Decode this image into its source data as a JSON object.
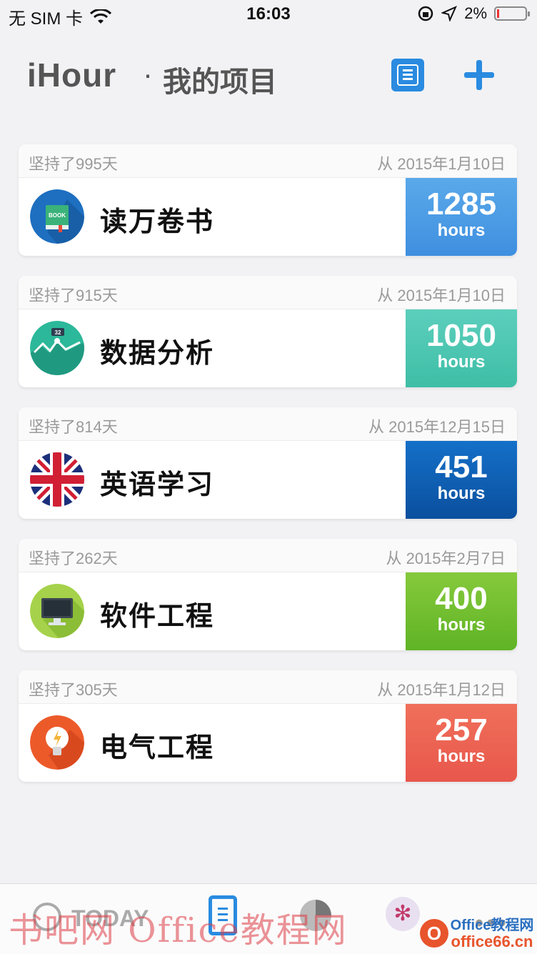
{
  "status_bar": {
    "carrier": "无 SIM 卡",
    "time": "16:03",
    "battery": "2%"
  },
  "header": {
    "app_name": "iHour",
    "separator": "·",
    "subtitle": "我的项目"
  },
  "projects": [
    {
      "days": "坚持了995天",
      "since": "从 2015年1月10日",
      "name": "读万卷书",
      "hours": "1285",
      "unit": "hours",
      "icon": "book-icon",
      "color_top": "#5aa9ea",
      "color_bottom": "#3f8fe0"
    },
    {
      "days": "坚持了915天",
      "since": "从 2015年1月10日",
      "name": "数据分析",
      "hours": "1050",
      "unit": "hours",
      "icon": "chart-icon",
      "color_top": "#5ccfbd",
      "color_bottom": "#3fbea6"
    },
    {
      "days": "坚持了814天",
      "since": "从 2015年12月15日",
      "name": "英语学习",
      "hours": "451",
      "unit": "hours",
      "icon": "uk-flag-icon",
      "color_top": "#1470c8",
      "color_bottom": "#0b4f9e"
    },
    {
      "days": "坚持了262天",
      "since": "从 2015年2月7日",
      "name": "软件工程",
      "hours": "400",
      "unit": "hours",
      "icon": "monitor-icon",
      "color_top": "#86c93c",
      "color_bottom": "#5fb425"
    },
    {
      "days": "坚持了305天",
      "since": "从 2015年1月12日",
      "name": "电气工程",
      "hours": "257",
      "unit": "hours",
      "icon": "bulb-icon",
      "color_top": "#f0705a",
      "color_bottom": "#e8574c"
    }
  ],
  "tabbar": {
    "today_label": "TODAY",
    "more": "•••"
  },
  "watermark": {
    "text": "书吧网 Office教程网",
    "badge": "O",
    "site_line1": "Office教程网",
    "site_line2": "office66.cn"
  }
}
